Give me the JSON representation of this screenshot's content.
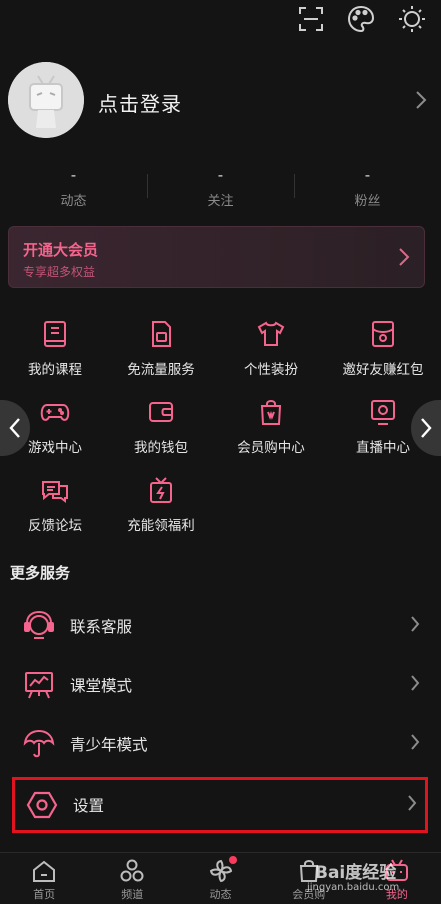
{
  "topbar": {
    "icons": [
      "scan-icon",
      "palette-icon",
      "theme-sun-icon"
    ]
  },
  "profile": {
    "login_text": "点击登录"
  },
  "stats": [
    {
      "value": "-",
      "label": "动态"
    },
    {
      "value": "-",
      "label": "关注"
    },
    {
      "value": "-",
      "label": "粉丝"
    }
  ],
  "vip": {
    "title": "开通大会员",
    "subtitle": "专享超多权益"
  },
  "grid": {
    "row1": [
      "我的课程",
      "免流量服务",
      "个性装扮",
      "邀好友赚红包"
    ],
    "row2": [
      "游戏中心",
      "我的钱包",
      "会员购中心",
      "直播中心"
    ],
    "row3": [
      "反馈论坛",
      "充能领福利"
    ]
  },
  "more_services": {
    "title": "更多服务",
    "items": [
      "联系客服",
      "课堂模式",
      "青少年模式",
      "设置"
    ]
  },
  "tabbar": [
    "首页",
    "频道",
    "动态",
    "会员购",
    "我的"
  ],
  "watermark": {
    "brand": "Bai度经验",
    "url": "jingyan.baidu.com"
  },
  "colors": {
    "accent": "#f5648d",
    "background": "#141414",
    "highlight_box": "#e0141e"
  }
}
